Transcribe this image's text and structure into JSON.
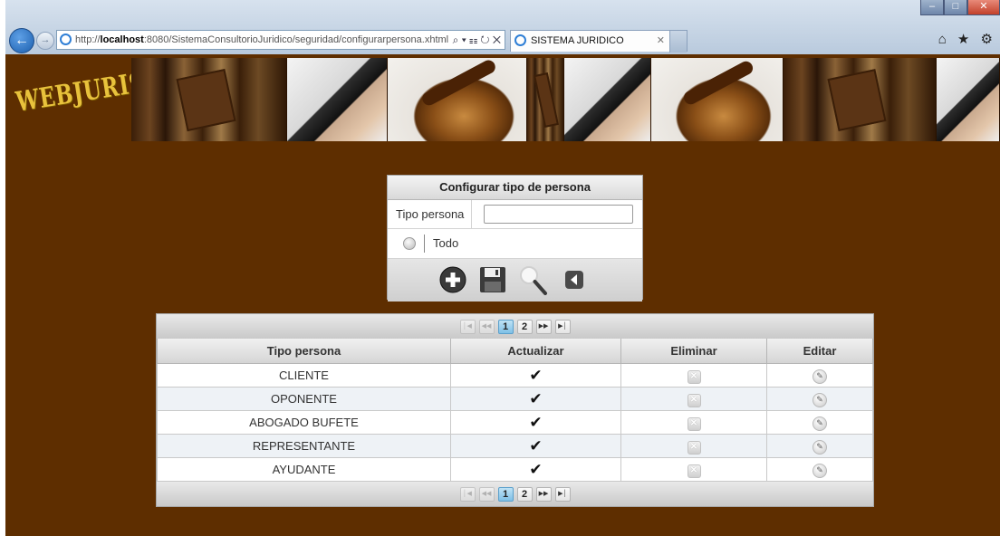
{
  "browser": {
    "url_prefix": "http://",
    "url_host": "localhost",
    "url_rest": ":8080/SistemaConsultorioJuridico/seguridad/configurarpersona.xhtml",
    "tab_title": "SISTEMA JURIDICO",
    "addr_tools": "⌕ ▾ ☷ ↻ ✕",
    "right_icons": "⌂ ★ ⚙"
  },
  "brand": {
    "logo_text": "WEBJURIS"
  },
  "form": {
    "title": "Configurar tipo de persona",
    "tipo_label": "Tipo persona",
    "tipo_value": "",
    "todo_label": "Todo"
  },
  "table": {
    "columns": [
      "Tipo persona",
      "Actualizar",
      "Eliminar",
      "Editar"
    ],
    "rows": [
      {
        "tipo": "CLIENTE"
      },
      {
        "tipo": "OPONENTE"
      },
      {
        "tipo": "ABOGADO BUFETE"
      },
      {
        "tipo": "REPRESENTANTE"
      },
      {
        "tipo": "AYUDANTE"
      }
    ],
    "pager": {
      "pages": [
        "1",
        "2"
      ],
      "current": "1"
    }
  },
  "icons": {
    "add": "plus-circle-icon",
    "save": "floppy-disk-icon",
    "search": "magnifier-icon",
    "back": "back-arrow-icon",
    "update": "checkmark-icon",
    "delete": "delete-x-icon",
    "edit": "pencil-icon"
  },
  "colors": {
    "page_background": "#5e2e00",
    "logo": "#e8c23c",
    "active_page": "#7fc0e6"
  }
}
